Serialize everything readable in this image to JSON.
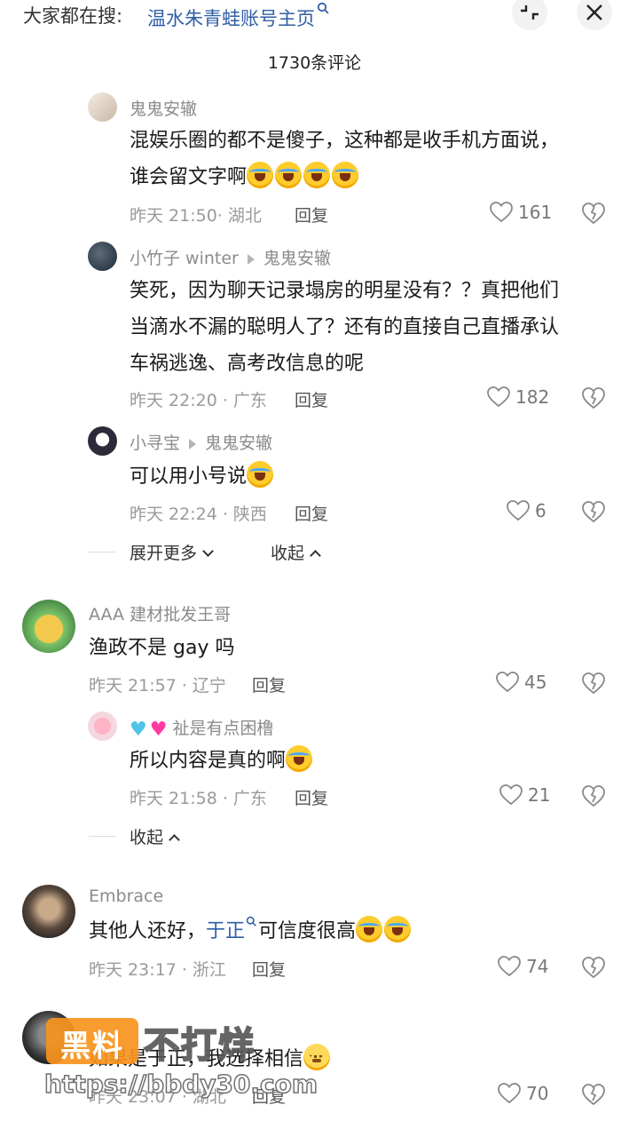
{
  "header": {
    "search_prefix": "大家都在搜:",
    "search_link": "温水朱青蛙账号主页",
    "comment_count": "1730条评论"
  },
  "comments": [
    {
      "name": "鬼鬼安辙",
      "body_line1": "混娱乐圈的都不是傻子，这种都是收手机方面说，",
      "body_line2": "谁会留文字啊",
      "meta": "昨天 21:50· 湖北",
      "reply": "回复",
      "likes": "161"
    },
    {
      "name": "小竹子 winter",
      "reply_to": "鬼鬼安辙",
      "body_line1": "笑死，因为聊天记录塌房的明星没有？？真把他们",
      "body_line2": "当滴水不漏的聪明人了？还有的直接自己直播承认",
      "body_line3": "车祸逃逸、高考改信息的呢",
      "meta": "昨天 22:20 · 广东",
      "reply": "回复",
      "likes": "182"
    },
    {
      "name": "小寻宝",
      "reply_to": "鬼鬼安辙",
      "body": "可以用小号说",
      "meta": "昨天 22:24 · 陕西",
      "reply": "回复",
      "likes": "6"
    },
    {
      "name": "AAA 建材批发王哥",
      "body": "渔政不是 gay 吗",
      "meta": "昨天 21:57 · 辽宁",
      "reply": "回复",
      "likes": "45"
    },
    {
      "name": "祉是有点困橹",
      "body": "所以内容是真的啊",
      "meta": "昨天 21:58 · 广东",
      "reply": "回复",
      "likes": "21"
    },
    {
      "name": "Embrace",
      "body_prefix": "其他人还好，",
      "body_link": "于正",
      "body_suffix": "可信度很高",
      "meta": "昨天 23:17 · 浙江",
      "reply": "回复",
      "likes": "74"
    },
    {
      "body": "如果是于正，我选择相信",
      "meta": "昨天 23:07 · 湖北",
      "reply": "回复",
      "likes": "70"
    }
  ],
  "controls": {
    "expand_more": "展开更多",
    "collapse": "收起"
  },
  "watermark": {
    "badge": "黑料",
    "text": "不打烊",
    "url": "https://bbdy30.com"
  }
}
